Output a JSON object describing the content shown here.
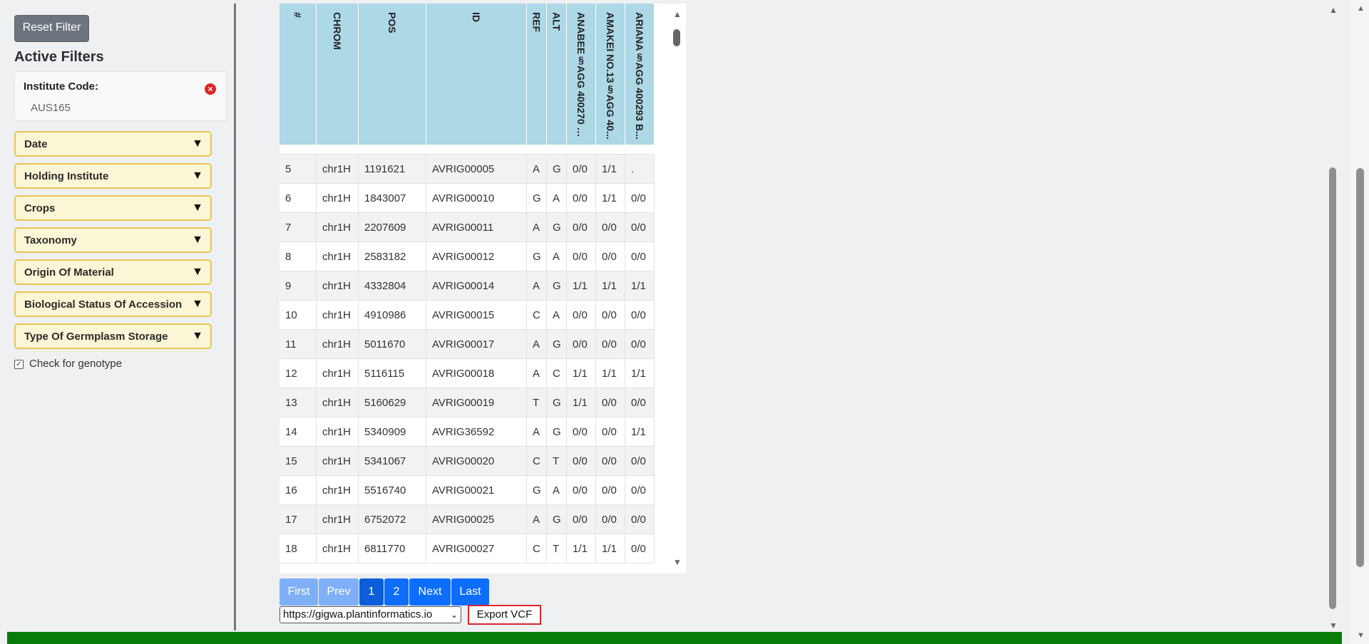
{
  "sidebar": {
    "reset_label": "Reset Filter",
    "active_title": "Active Filters",
    "active_filter": {
      "label": "Institute Code:",
      "value": "AUS165"
    },
    "facets": [
      "Date",
      "Holding Institute",
      "Crops",
      "Taxonomy",
      "Origin Of Material",
      "Biological Status Of Accession",
      "Type Of Germplasm Storage"
    ],
    "genotype_label": "Check for genotype",
    "genotype_checked": true
  },
  "table": {
    "headers": [
      "#",
      "CHROM",
      "POS",
      "ID",
      "REF",
      "ALT",
      "ANABEE§AGG 400270 B...",
      "AMAKEI NO.13§AGG 40...",
      "ARIANA§AGG 400293 B..."
    ],
    "rows": [
      [
        "5",
        "chr1H",
        "1191621",
        "AVRIG00005",
        "A",
        "G",
        "0/0",
        "1/1",
        "."
      ],
      [
        "6",
        "chr1H",
        "1843007",
        "AVRIG00010",
        "G",
        "A",
        "0/0",
        "1/1",
        "0/0"
      ],
      [
        "7",
        "chr1H",
        "2207609",
        "AVRIG00011",
        "A",
        "G",
        "0/0",
        "0/0",
        "0/0"
      ],
      [
        "8",
        "chr1H",
        "2583182",
        "AVRIG00012",
        "G",
        "A",
        "0/0",
        "0/0",
        "0/0"
      ],
      [
        "9",
        "chr1H",
        "4332804",
        "AVRIG00014",
        "A",
        "G",
        "1/1",
        "1/1",
        "1/1"
      ],
      [
        "10",
        "chr1H",
        "4910986",
        "AVRIG00015",
        "C",
        "A",
        "0/0",
        "0/0",
        "0/0"
      ],
      [
        "11",
        "chr1H",
        "5011670",
        "AVRIG00017",
        "A",
        "G",
        "0/0",
        "0/0",
        "0/0"
      ],
      [
        "12",
        "chr1H",
        "5116115",
        "AVRIG00018",
        "A",
        "C",
        "1/1",
        "1/1",
        "1/1"
      ],
      [
        "13",
        "chr1H",
        "5160629",
        "AVRIG00019",
        "T",
        "G",
        "1/1",
        "0/0",
        "0/0"
      ],
      [
        "14",
        "chr1H",
        "5340909",
        "AVRIG36592",
        "A",
        "G",
        "0/0",
        "0/0",
        "1/1"
      ],
      [
        "15",
        "chr1H",
        "5341067",
        "AVRIG00020",
        "C",
        "T",
        "0/0",
        "0/0",
        "0/0"
      ],
      [
        "16",
        "chr1H",
        "5516740",
        "AVRIG00021",
        "G",
        "A",
        "0/0",
        "0/0",
        "0/0"
      ],
      [
        "17",
        "chr1H",
        "6752072",
        "AVRIG00025",
        "A",
        "G",
        "0/0",
        "0/0",
        "0/0"
      ],
      [
        "18",
        "chr1H",
        "6811770",
        "AVRIG00027",
        "C",
        "T",
        "1/1",
        "1/1",
        "0/0"
      ]
    ]
  },
  "pagination": {
    "first": "First",
    "prev": "Prev",
    "pages": [
      "1",
      "2"
    ],
    "next": "Next",
    "last": "Last"
  },
  "export": {
    "server_option": "https://gigwa.plantinformatics.io",
    "button_label": "Export VCF"
  },
  "colors": {
    "header_bg": "#add8e6",
    "facet_bg": "#fbf6d5",
    "facet_border": "#e8c652",
    "pager_active": "#0b5ed7",
    "footer": "#087c08",
    "export_border": "#d9262c"
  },
  "icons": {
    "remove_filter": "close-circle-icon",
    "facet_toggle": "triangle-down-icon"
  }
}
